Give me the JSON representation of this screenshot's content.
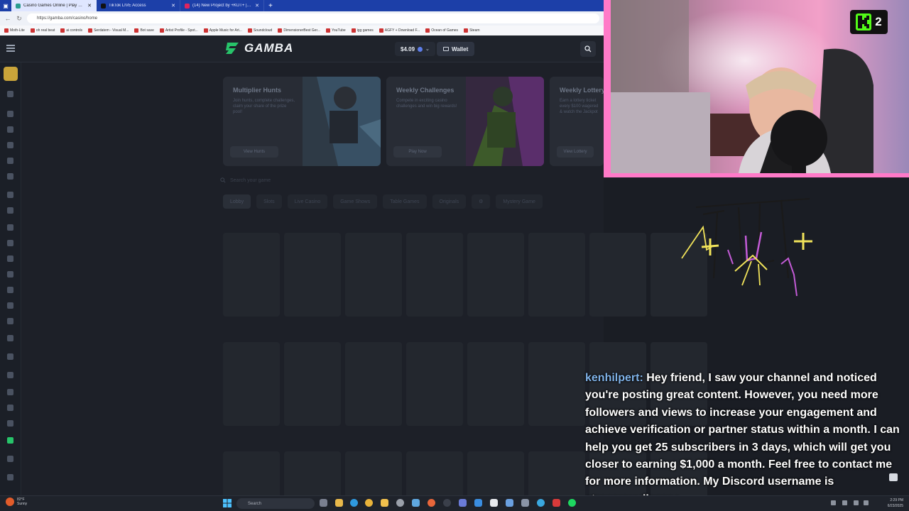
{
  "browser": {
    "tabs": [
      {
        "title": "Casino Games Online | Play Cryp",
        "favicon_color": "#2a9d8f",
        "active": true
      },
      {
        "title": "TikTok LIVE Access",
        "favicon_color": "#111111",
        "active": false
      },
      {
        "title": "(14) New Project by +KUT+ | Ban",
        "favicon_color": "#e0245e",
        "active": false
      }
    ],
    "url": "https://gamba.com/casino/home",
    "bookmarks": [
      "Moth-Lite",
      "oh real beat",
      "ai controls",
      "Serdatem - Visual M...",
      "Bot save",
      "Artist Profile - Spot...",
      "Apple Music for Art...",
      "Soundcloud",
      "DimensionerBest Ger...",
      "YouTube",
      "igg games",
      "AGFY + Download F...",
      "Ocean of Games",
      "Steam"
    ]
  },
  "site": {
    "logo_text": "GAMBA",
    "balance": "$4.09",
    "wallet_label": "Wallet",
    "accent_color": "#27c46a"
  },
  "promos": [
    {
      "title": "Multiplier Hunts",
      "desc": "Join hunts, complete challenges, claim your share of the prize pool!",
      "button": "View Hunts"
    },
    {
      "title": "Weekly Challenges",
      "desc": "Compete in exciting casino challenges and win big rewards!",
      "button": "Play Now"
    },
    {
      "title": "Weekly Lottery",
      "desc": "Earn a lottery ticket every $100 wagered & watch the Jackpot grow!",
      "button": "View Lottery"
    }
  ],
  "game_search_placeholder": "Search your game",
  "categories": [
    "Lobby",
    "Slots",
    "Live Casino",
    "Game Shows",
    "Table Games",
    "Originals",
    "Mystery Game"
  ],
  "overlay": {
    "kick_viewers": "2"
  },
  "chat": {
    "username": "kenhilpert:",
    "message": "Hey friend, I saw your channel and noticed you're posting great content. However, you need more followers and views to increase your engagement and achieve verification or partner status within a month. I can help you get 25 subscribers in 3 days, which will get you closer to earning $1,000 a month. Feel free to contact me for more information. My Discord username is streammediaproo"
  },
  "taskbar": {
    "weather_temp": "82°F",
    "weather_desc": "Sunny",
    "search_label": "Search",
    "time": "2:29 PM",
    "date": "6/23/2025"
  }
}
